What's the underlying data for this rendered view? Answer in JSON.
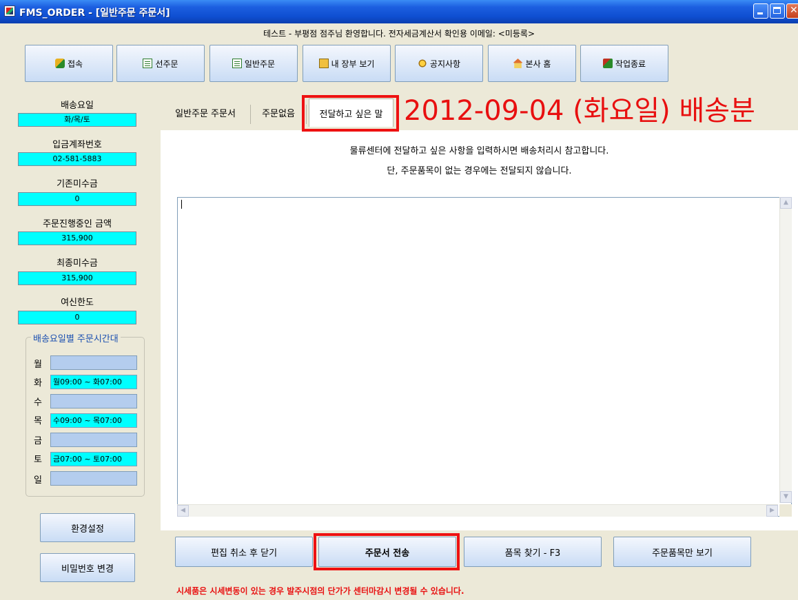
{
  "window": {
    "title": "FMS_ORDER - [일반주문 주문서]",
    "controls": [
      "minimize",
      "maximize",
      "close"
    ]
  },
  "welcome_text": "테스트 - 부평점 점주님 환영합니다.   전자세금계산서 확인용 이메일: <미등록>",
  "toolbar": [
    {
      "label": "접속",
      "icon": "plug-icon"
    },
    {
      "label": "선주문",
      "icon": "list-icon"
    },
    {
      "label": "일반주문",
      "icon": "list-icon"
    },
    {
      "label": "내 장부 보기",
      "icon": "book-icon"
    },
    {
      "label": "공지사항",
      "icon": "speaker-icon"
    },
    {
      "label": "본사 홈",
      "icon": "home-icon"
    },
    {
      "label": "작업종료",
      "icon": "exit-icon"
    }
  ],
  "left_panel": {
    "fields": [
      {
        "label": "배송요일",
        "value": "화/목/토"
      },
      {
        "label": "입금계좌번호",
        "value": "02-581-5883"
      },
      {
        "label": "기존미수금",
        "value": "0"
      },
      {
        "label": "주문진행중인 금액",
        "value": "315,900"
      },
      {
        "label": "최종미수금",
        "value": "315,900"
      },
      {
        "label": "여신한도",
        "value": "0"
      }
    ],
    "schedule_title": "배송요일별 주문시간대",
    "schedule": [
      {
        "day": "월",
        "time": ""
      },
      {
        "day": "화",
        "time": "월09:00 ~ 화07:00"
      },
      {
        "day": "수",
        "time": ""
      },
      {
        "day": "목",
        "time": "수09:00 ~ 목07:00"
      },
      {
        "day": "금",
        "time": ""
      },
      {
        "day": "토",
        "time": "금07:00 ~ 토07:00"
      },
      {
        "day": "일",
        "time": ""
      }
    ],
    "buttons": {
      "settings": "환경설정",
      "change_password": "비밀번호 변경"
    }
  },
  "tabs": [
    {
      "label": "일반주문 주문서",
      "selected": false
    },
    {
      "label": "주문없음",
      "selected": false
    },
    {
      "label": "전달하고 싶은 말",
      "selected": true
    }
  ],
  "delivery_date": "2012-09-04 (화요일) 배송분",
  "instructions": [
    "물류센터에 전달하고 싶은 사항을 입력하시면 배송처리시 참고합니다.",
    "단, 주문품목이 없는 경우에는 전달되지 않습니다."
  ],
  "memo": {
    "value": ""
  },
  "actions": {
    "cancel_close": "편집 취소 후 닫기",
    "send_order": "주문서 전송",
    "find_item": "품목 찾기 - F3",
    "view_items": "주문품목만 보기"
  },
  "warning": "시세품은 시세변동이 있는 경우 발주시점의 단가가 센터마감시 변경될 수 있습니다.",
  "colors": {
    "highlight_frame": "#ee1111",
    "value_field_bg": "#00ffff",
    "date_title": "#e81010",
    "titlebar": "#0f4fd2"
  }
}
